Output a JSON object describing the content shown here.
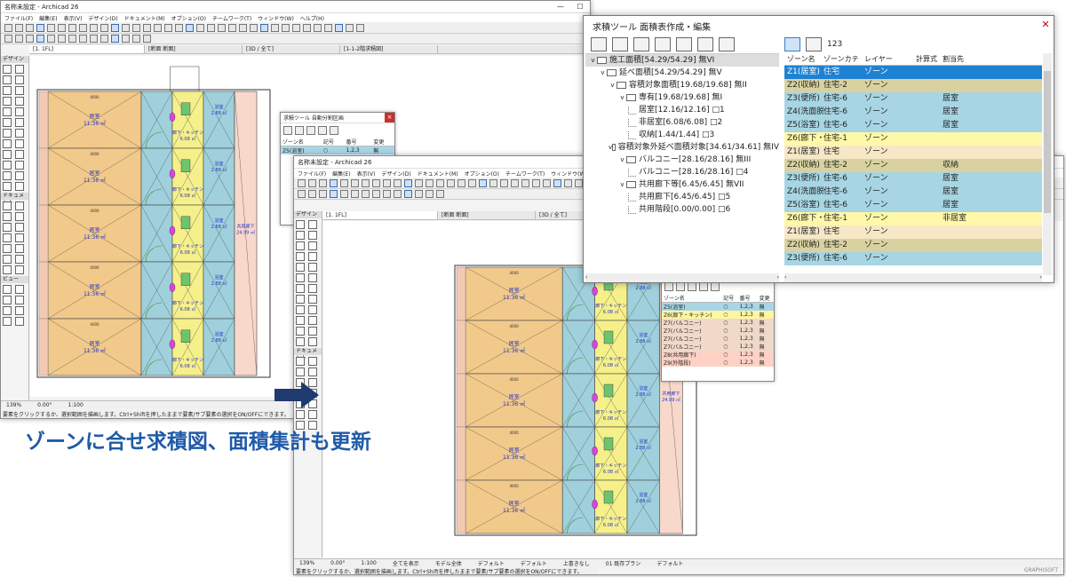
{
  "app1": {
    "title": "名称未設定 - Archicad 26",
    "menu": [
      "ファイル(F)",
      "編集(E)",
      "表示(V)",
      "デザイン(D)",
      "ドキュメント(M)",
      "オプション(O)",
      "チームワーク(T)",
      "ウィンドウ(W)",
      "ヘルプ(H)"
    ],
    "tabs": [
      "[1. 1FL]",
      "[断面 断面]",
      "[3D / 全て]",
      "[1-1-2階求積図]"
    ],
    "toolbox_sections": [
      "デザイン",
      "ドキュメント",
      "ビュー"
    ],
    "status": [
      "139%",
      "0.00°",
      "1:100"
    ],
    "hint": "要素をクリックするか、選択範囲を描画します。Ctrl+Shiftを押したままで要素/サブ要素の選択をON/OFFにできます。"
  },
  "small_panel": {
    "title": "求積ツール 自動分割区画",
    "headers": [
      "ゾーン名",
      "記号",
      "番号",
      "変更"
    ],
    "rows": [
      {
        "name": "Z5(浴室)",
        "sym": "○",
        "num": "1,2,3",
        "chg": "無"
      }
    ]
  },
  "app2": {
    "title": "名称未設定 - Archicad 26",
    "menu": [
      "ファイル(F)",
      "編集(E)",
      "表示(V)",
      "デザイン(D)",
      "ドキュメント(M)",
      "オプション(O)",
      "チームワーク(T)",
      "ウィンドウ(W)",
      "ヘルプ(H)"
    ],
    "tabs": [
      "[1. 1FL]",
      "[断面 断面]",
      "[3D / 全て]"
    ],
    "toolbox_sections": [
      "デザイン",
      "ドキュメント"
    ],
    "status": [
      "139%",
      "0.00°",
      "1:100",
      "全てを表示",
      "モデル全体",
      "デフォルト",
      "デフォルト",
      "上書きなし",
      "01 既存プラン",
      "デフォルト"
    ],
    "hint": "要素をクリックするか、選択範囲を描画します。Ctrl+Shiftを押したままで要素/サブ要素の選択をON/OFFにできます。",
    "brand": "GRAPHISOFT"
  },
  "panel2": {
    "headers": [
      "ゾーン名",
      "記号",
      "番号",
      "変更"
    ],
    "rows": [
      {
        "name": "Z5(浴室)",
        "sym": "○",
        "num": "1,2,3",
        "chg": "無",
        "cls": "rowS"
      },
      {
        "name": "Z6(廊下・キッチン)",
        "sym": "○",
        "num": "1,2,3",
        "chg": "無",
        "cls": "rowY"
      },
      {
        "name": "Z7(バルコニー)",
        "sym": "○",
        "num": "1,2,3",
        "chg": "無",
        "cls": "rowB"
      },
      {
        "name": "Z7(バルコニー)",
        "sym": "○",
        "num": "1,2,3",
        "chg": "無",
        "cls": "rowB"
      },
      {
        "name": "Z7(バルコニー)",
        "sym": "○",
        "num": "1,2,3",
        "chg": "無",
        "cls": "rowB"
      },
      {
        "name": "Z7(バルコニー)",
        "sym": "○",
        "num": "1,2,3",
        "chg": "無",
        "cls": "rowB"
      },
      {
        "name": "Z8(共用廊下)",
        "sym": "○",
        "num": "1,2,3",
        "chg": "無",
        "cls": "rowP"
      },
      {
        "name": "Z9(外階段)",
        "sym": "○",
        "num": "1,2,3",
        "chg": "無",
        "cls": "rowP"
      }
    ]
  },
  "tree_window": {
    "title": "求積ツール 面積表作成・編集",
    "close": "✕",
    "count_icon_label": "123",
    "tree": [
      {
        "level": 0,
        "kind": "folder",
        "text": "施工面積[54.29/54.29] 無VI",
        "sel": true
      },
      {
        "level": 1,
        "kind": "folder",
        "text": "延べ面積[54.29/54.29] 無V"
      },
      {
        "level": 2,
        "kind": "folder",
        "text": "容積対象面積[19.68/19.68] 無II"
      },
      {
        "level": 3,
        "kind": "folder",
        "text": "専有[19.68/19.68] 無I"
      },
      {
        "level": 4,
        "kind": "leaf",
        "text": "居室[12.16/12.16] □1"
      },
      {
        "level": 4,
        "kind": "leaf",
        "text": "非居室[6.08/6.08] □2"
      },
      {
        "level": 4,
        "kind": "leaf",
        "text": "収納[1.44/1.44] □3"
      },
      {
        "level": 2,
        "kind": "folder",
        "text": "容積対象外延べ面積対象[34.61/34.61] 無IV"
      },
      {
        "level": 3,
        "kind": "folder",
        "text": "バルコニー[28.16/28.16] 無III"
      },
      {
        "level": 4,
        "kind": "leaf",
        "text": "バルコニー[28.16/28.16] □4"
      },
      {
        "level": 3,
        "kind": "folder",
        "text": "共用廊下等[6.45/6.45] 無VII"
      },
      {
        "level": 4,
        "kind": "leaf",
        "text": "共用廊下[6.45/6.45] □5"
      },
      {
        "level": 4,
        "kind": "leaf",
        "text": "共用階段[0.00/0.00] □6"
      }
    ],
    "zone_headers": [
      "ゾーン名",
      "ゾーンカテゴリ",
      "レイヤー",
      "計算式",
      "割当先"
    ],
    "zones": [
      {
        "name": "Z1(居室)",
        "cat": "住宅",
        "layer": "ゾーン",
        "calc": "",
        "assign": "",
        "cls": "selr"
      },
      {
        "name": "Z2(収納)",
        "cat": "住宅-2",
        "layer": "ゾーン",
        "calc": "",
        "assign": "",
        "cls": "olv"
      },
      {
        "name": "Z3(便所)",
        "cat": "住宅-6",
        "layer": "ゾーン",
        "calc": "",
        "assign": "居室",
        "cls": "cy"
      },
      {
        "name": "Z4(洗面脱",
        "cat": "住宅-6",
        "layer": "ゾーン",
        "calc": "",
        "assign": "居室",
        "cls": "cy"
      },
      {
        "name": "Z5(浴室)",
        "cat": "住宅-6",
        "layer": "ゾーン",
        "calc": "",
        "assign": "居室",
        "cls": "cy"
      },
      {
        "name": "Z6(廊下・キ",
        "cat": "住宅-1",
        "layer": "ゾーン",
        "calc": "",
        "assign": "",
        "cls": "ys"
      },
      {
        "name": "Z1(居室)",
        "cat": "住宅",
        "layer": "ゾーン",
        "calc": "",
        "assign": "",
        "cls": "pale"
      },
      {
        "name": "Z2(収納)",
        "cat": "住宅-2",
        "layer": "ゾーン",
        "calc": "",
        "assign": "収納",
        "cls": "olv"
      },
      {
        "name": "Z3(便所)",
        "cat": "住宅-6",
        "layer": "ゾーン",
        "calc": "",
        "assign": "居室",
        "cls": "cy"
      },
      {
        "name": "Z4(洗面脱",
        "cat": "住宅-6",
        "layer": "ゾーン",
        "calc": "",
        "assign": "居室",
        "cls": "cy"
      },
      {
        "name": "Z5(浴室)",
        "cat": "住宅-6",
        "layer": "ゾーン",
        "calc": "",
        "assign": "居室",
        "cls": "cy"
      },
      {
        "name": "Z6(廊下・キ",
        "cat": "住宅-1",
        "layer": "ゾーン",
        "calc": "",
        "assign": "非居室",
        "cls": "ys"
      },
      {
        "name": "Z1(居室)",
        "cat": "住宅",
        "layer": "ゾーン",
        "calc": "",
        "assign": "",
        "cls": "pale"
      },
      {
        "name": "Z2(収納)",
        "cat": "住宅-2",
        "layer": "ゾーン",
        "calc": "",
        "assign": "",
        "cls": "olv"
      },
      {
        "name": "Z3(便所)",
        "cat": "住宅-6",
        "layer": "ゾーン",
        "calc": "",
        "assign": "",
        "cls": "cy"
      }
    ]
  },
  "plan_labels": {
    "room": "居室",
    "room_area": "11.36 ㎡",
    "corridor": "廊下・キッチン",
    "corridor_area": "6.08 ㎡",
    "bath": "浴室",
    "bath_area": "2.88 ㎡",
    "shared": "共用廊下",
    "shared_area": "24.99 ㎡",
    "dim": "4000"
  },
  "caption": "ゾーンに合せ求積図、面積集計も更新",
  "colors": {
    "accent": "#1f5aa8",
    "select": "#1e82d2",
    "tan": "#f1c98a",
    "teal": "#9fd0dc",
    "yellow": "#f6f08a",
    "salmon": "#f4c9b4"
  }
}
